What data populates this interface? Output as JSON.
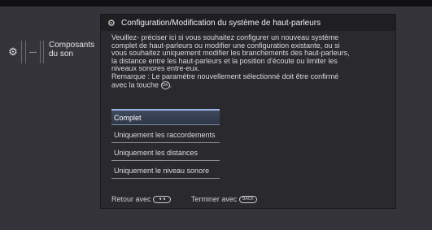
{
  "menu": {
    "gear_icon": "gear-icon",
    "dots": "---",
    "item_sound": "Composants du son"
  },
  "dialog": {
    "title": "Configuration/Modification du système de haut-parleurs",
    "intro": "Veuillez- préciser ici si vous souhaitez configurer un nouveau système complet de haut-parleurs ou modifier une configuration existante, ou si vous souhaitez uniquement modifier les branchements des haut-parleurs, la distance entre les haut-parleurs et la position d'écoute ou limiter les niveaux sonores entre-eux.",
    "remark": "Remarque : Le paramètre nouvellement sélectionné doit être confirmé avec la touche",
    "ok_key_label": "OK",
    "options": [
      "Complet",
      "Uniquement les raccordements",
      "Uniquement les distances",
      "Uniquement le niveau sonore"
    ],
    "footer": {
      "back_label": "Retour avec",
      "back_key": "◄◄",
      "finish_label": "Terminer avec",
      "finish_key": "BACK"
    }
  }
}
